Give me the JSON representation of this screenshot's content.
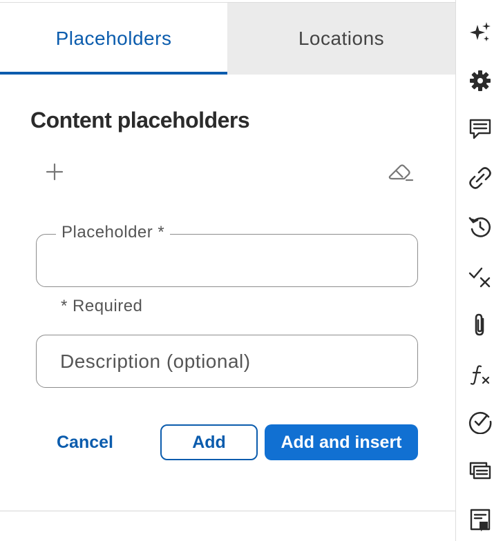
{
  "tabs": [
    {
      "label": "Placeholders",
      "active": true
    },
    {
      "label": "Locations",
      "active": false
    }
  ],
  "section": {
    "title": "Content placeholders"
  },
  "toolbar": {
    "add_icon": "plus-icon",
    "clear_icon": "eraser-icon"
  },
  "form": {
    "placeholder_label": "Placeholder *",
    "placeholder_value": "",
    "required_note": "* Required",
    "description_placeholder": "Description (optional)",
    "description_value": ""
  },
  "actions": {
    "cancel_label": "Cancel",
    "add_label": "Add",
    "add_insert_label": "Add and insert"
  },
  "rail": {
    "icons": [
      "sparkle-icon",
      "gear-icon",
      "comment-icon",
      "link-icon",
      "history-icon",
      "check-cross-icon",
      "paperclip-icon",
      "formula-icon",
      "check-circle-icon",
      "cards-icon",
      "note-icon"
    ]
  },
  "colors": {
    "accent": "#0b5cad",
    "primary_button": "#1170d2",
    "inactive_tab": "#ebebeb",
    "border": "#8c8c8c"
  }
}
